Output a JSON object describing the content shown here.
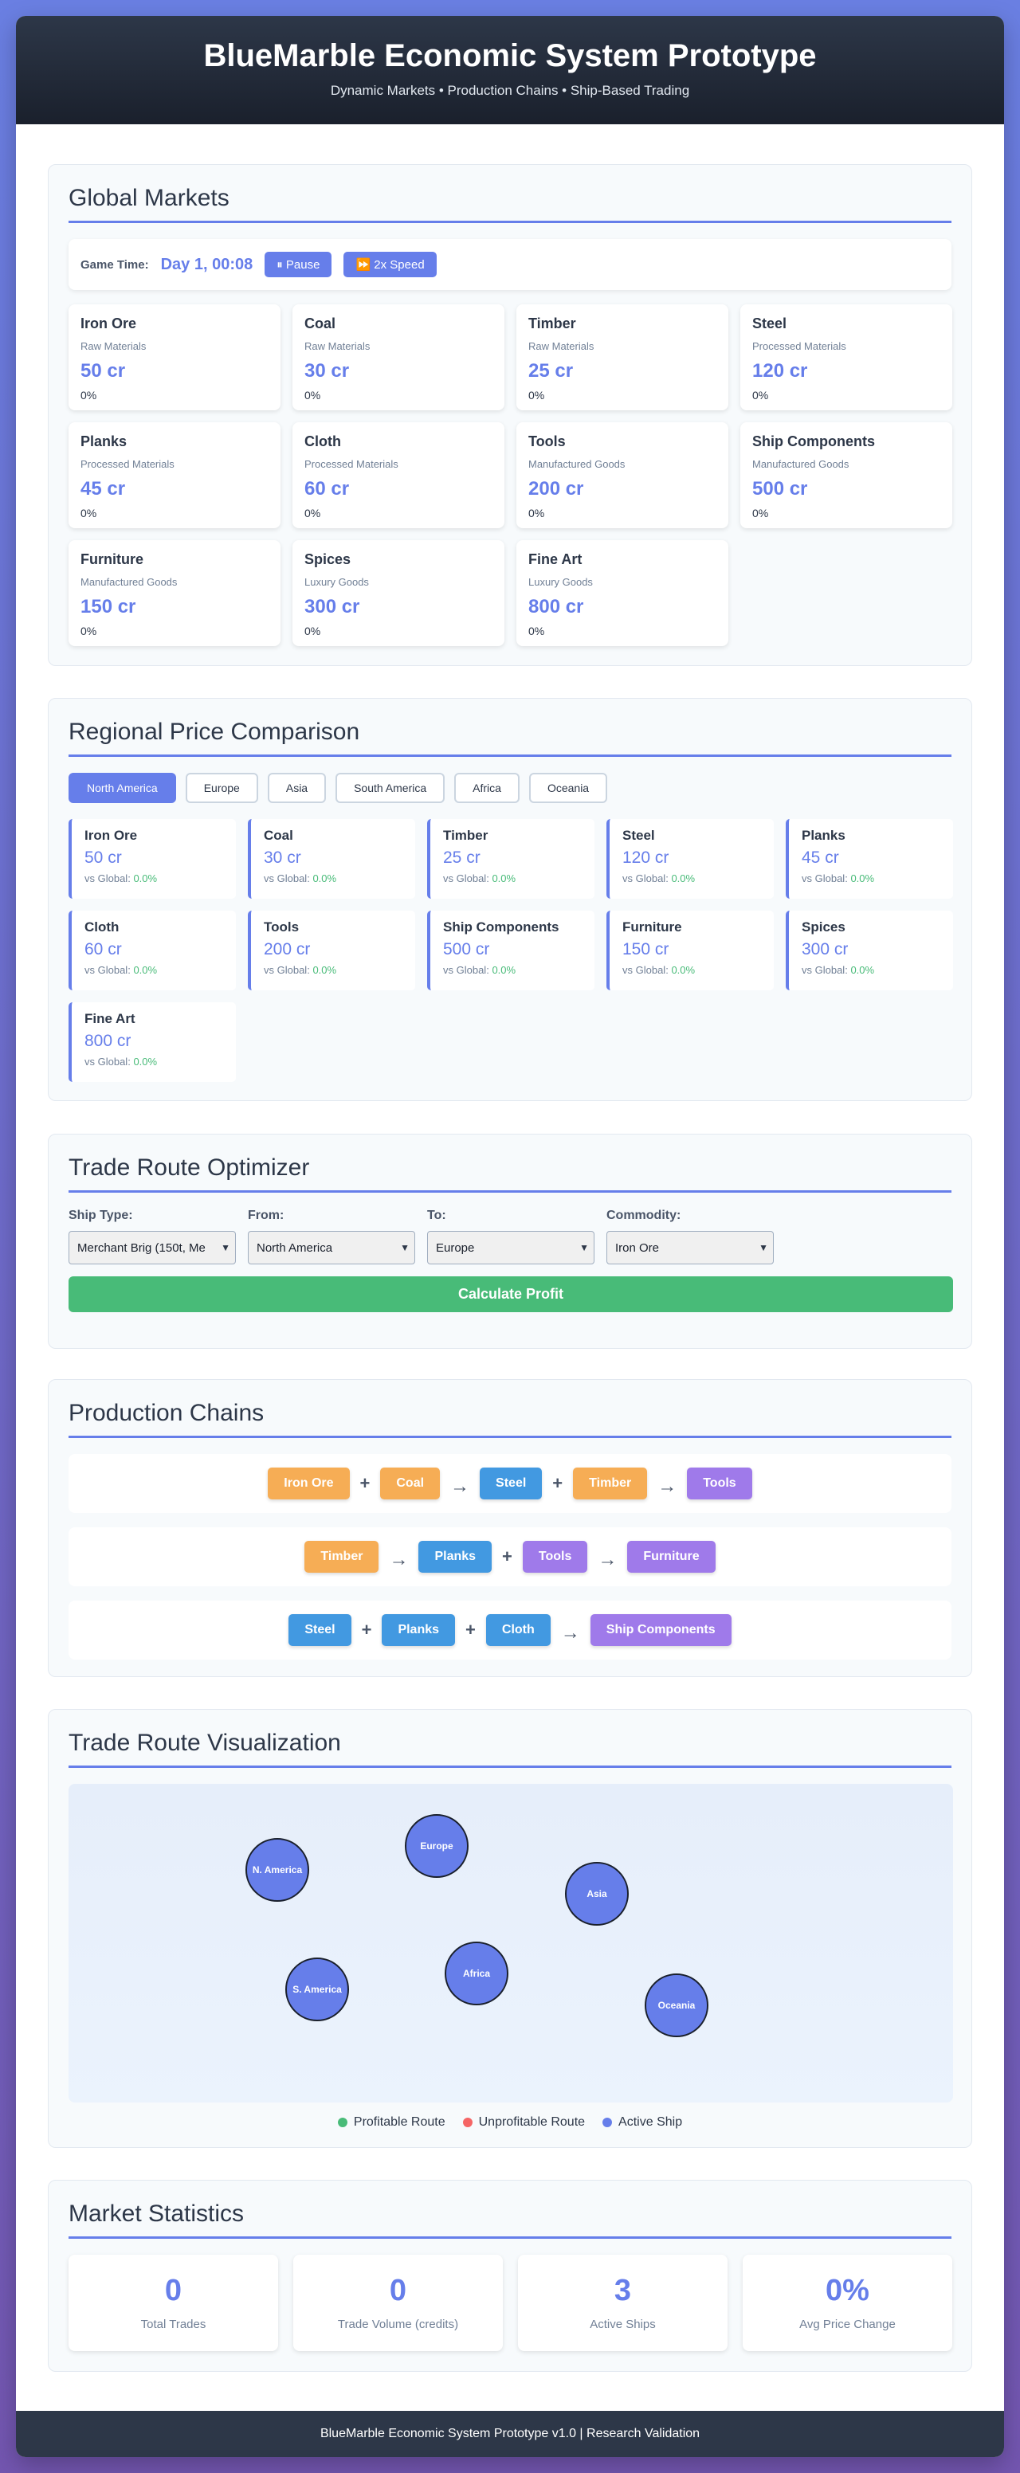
{
  "header": {
    "title": "BlueMarble Economic System Prototype",
    "subtitle": "Dynamic Markets • Production Chains • Ship-Based Trading"
  },
  "global_markets": {
    "heading": "Global Markets",
    "game_time_label": "Game Time:",
    "game_time": "Day 1, 00:08",
    "pause_label": "⏸ Pause",
    "speed_label": "⏩ 2x Speed",
    "items": [
      {
        "name": "Iron Ore",
        "category": "Raw Materials",
        "price": "50 cr",
        "change": "0%"
      },
      {
        "name": "Coal",
        "category": "Raw Materials",
        "price": "30 cr",
        "change": "0%"
      },
      {
        "name": "Timber",
        "category": "Raw Materials",
        "price": "25 cr",
        "change": "0%"
      },
      {
        "name": "Steel",
        "category": "Processed Materials",
        "price": "120 cr",
        "change": "0%"
      },
      {
        "name": "Planks",
        "category": "Processed Materials",
        "price": "45 cr",
        "change": "0%"
      },
      {
        "name": "Cloth",
        "category": "Processed Materials",
        "price": "60 cr",
        "change": "0%"
      },
      {
        "name": "Tools",
        "category": "Manufactured Goods",
        "price": "200 cr",
        "change": "0%"
      },
      {
        "name": "Ship Components",
        "category": "Manufactured Goods",
        "price": "500 cr",
        "change": "0%"
      },
      {
        "name": "Furniture",
        "category": "Manufactured Goods",
        "price": "150 cr",
        "change": "0%"
      },
      {
        "name": "Spices",
        "category": "Luxury Goods",
        "price": "300 cr",
        "change": "0%"
      },
      {
        "name": "Fine Art",
        "category": "Luxury Goods",
        "price": "800 cr",
        "change": "0%"
      }
    ]
  },
  "regional": {
    "heading": "Regional Price Comparison",
    "tabs": [
      "North America",
      "Europe",
      "Asia",
      "South America",
      "Africa",
      "Oceania"
    ],
    "active_tab": "North America",
    "vs_label": "vs Global:",
    "items": [
      {
        "name": "Iron Ore",
        "price": "50 cr",
        "vs": "0.0%"
      },
      {
        "name": "Coal",
        "price": "30 cr",
        "vs": "0.0%"
      },
      {
        "name": "Timber",
        "price": "25 cr",
        "vs": "0.0%"
      },
      {
        "name": "Steel",
        "price": "120 cr",
        "vs": "0.0%"
      },
      {
        "name": "Planks",
        "price": "45 cr",
        "vs": "0.0%"
      },
      {
        "name": "Cloth",
        "price": "60 cr",
        "vs": "0.0%"
      },
      {
        "name": "Tools",
        "price": "200 cr",
        "vs": "0.0%"
      },
      {
        "name": "Ship Components",
        "price": "500 cr",
        "vs": "0.0%"
      },
      {
        "name": "Furniture",
        "price": "150 cr",
        "vs": "0.0%"
      },
      {
        "name": "Spices",
        "price": "300 cr",
        "vs": "0.0%"
      },
      {
        "name": "Fine Art",
        "price": "800 cr",
        "vs": "0.0%"
      }
    ]
  },
  "optimizer": {
    "heading": "Trade Route Optimizer",
    "ship_label": "Ship Type:",
    "ship_value": "Merchant Brig (150t, Me",
    "from_label": "From:",
    "from_value": "North America",
    "to_label": "To:",
    "to_value": "Europe",
    "commodity_label": "Commodity:",
    "commodity_value": "Iron Ore",
    "calculate_label": "Calculate Profit"
  },
  "chains": {
    "heading": "Production Chains",
    "rows": [
      [
        {
          "kind": "node",
          "label": "Iron Ore",
          "tier": "raw"
        },
        {
          "kind": "op",
          "label": "+"
        },
        {
          "kind": "node",
          "label": "Coal",
          "tier": "raw"
        },
        {
          "kind": "arrow",
          "label": "→"
        },
        {
          "kind": "node",
          "label": "Steel",
          "tier": "processed"
        },
        {
          "kind": "op",
          "label": "+"
        },
        {
          "kind": "node",
          "label": "Timber",
          "tier": "raw"
        },
        {
          "kind": "arrow",
          "label": "→"
        },
        {
          "kind": "node",
          "label": "Tools",
          "tier": "manufactured"
        }
      ],
      [
        {
          "kind": "node",
          "label": "Timber",
          "tier": "raw"
        },
        {
          "kind": "arrow",
          "label": "→"
        },
        {
          "kind": "node",
          "label": "Planks",
          "tier": "processed"
        },
        {
          "kind": "op",
          "label": "+"
        },
        {
          "kind": "node",
          "label": "Tools",
          "tier": "manufactured"
        },
        {
          "kind": "arrow",
          "label": "→"
        },
        {
          "kind": "node",
          "label": "Furniture",
          "tier": "manufactured"
        }
      ],
      [
        {
          "kind": "node",
          "label": "Steel",
          "tier": "processed"
        },
        {
          "kind": "op",
          "label": "+"
        },
        {
          "kind": "node",
          "label": "Planks",
          "tier": "processed"
        },
        {
          "kind": "op",
          "label": "+"
        },
        {
          "kind": "node",
          "label": "Cloth",
          "tier": "processed"
        },
        {
          "kind": "arrow",
          "label": "→"
        },
        {
          "kind": "node",
          "label": "Ship Components",
          "tier": "manufactured"
        }
      ]
    ]
  },
  "visualization": {
    "heading": "Trade Route Visualization",
    "regions": [
      "N. America",
      "Europe",
      "Asia",
      "S. America",
      "Africa",
      "Oceania"
    ],
    "legend": [
      {
        "label": "Profitable Route",
        "color": "#48bb78"
      },
      {
        "label": "Unprofitable Route",
        "color": "#f56565"
      },
      {
        "label": "Active Ship",
        "color": "#667eea"
      }
    ]
  },
  "stats": {
    "heading": "Market Statistics",
    "items": [
      {
        "value": "0",
        "label": "Total Trades"
      },
      {
        "value": "0",
        "label": "Trade Volume (credits)"
      },
      {
        "value": "3",
        "label": "Active Ships"
      },
      {
        "value": "0%",
        "label": "Avg Price Change"
      }
    ]
  },
  "footer": {
    "text": "BlueMarble Economic System Prototype v1.0 | Research Validation"
  }
}
